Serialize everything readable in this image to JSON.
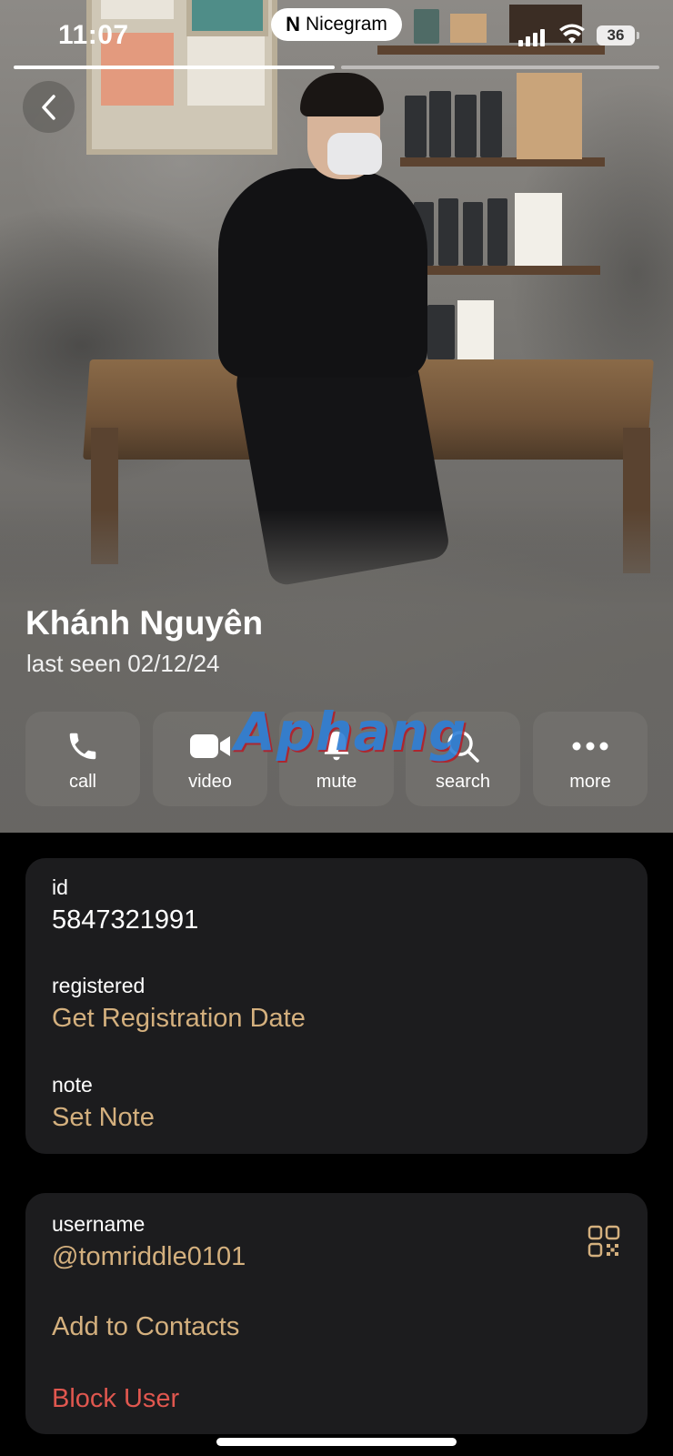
{
  "status_bar": {
    "time": "11:07",
    "island_label": "Nicegram",
    "battery": "36"
  },
  "profile": {
    "name": "Khánh Nguyên",
    "last_seen": "last seen 02/12/24"
  },
  "watermark": "Aphang",
  "actions": [
    {
      "label": "call",
      "icon": "phone-icon"
    },
    {
      "label": "video",
      "icon": "video-camera-icon"
    },
    {
      "label": "mute",
      "icon": "bell-icon"
    },
    {
      "label": "search",
      "icon": "search-icon"
    },
    {
      "label": "more",
      "icon": "more-dots-icon"
    }
  ],
  "info_card": {
    "id_label": "id",
    "id_value": "5847321991",
    "registered_label": "registered",
    "registered_value": "Get Registration Date",
    "note_label": "note",
    "note_value": "Set Note"
  },
  "contact_card": {
    "username_label": "username",
    "username_value": "@tomriddle0101",
    "add_contacts": "Add to Contacts",
    "block_user": "Block User"
  },
  "colors": {
    "accent_gold": "#d4b07e",
    "danger_red": "#e0574f",
    "card_bg": "#1c1c1e"
  }
}
